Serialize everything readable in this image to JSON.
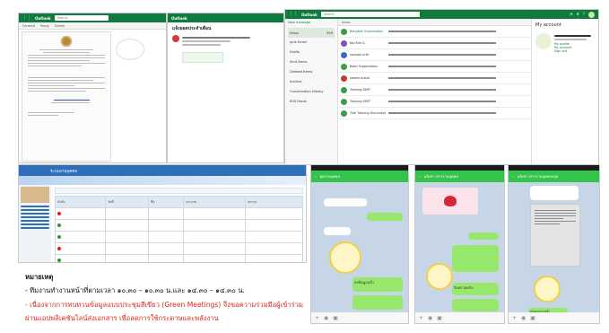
{
  "outlook_left": {
    "brand": "Outlook",
    "search_placeholder": "Search",
    "toolbar": [
      "Forward",
      "Reply",
      "Delete"
    ],
    "reader_title": "แจ้งยอดประจำเดือน"
  },
  "outlook_right": {
    "brand": "Outlook",
    "search_placeholder": "Search",
    "new_label": "New message",
    "folders": [
      "Inbox",
      "Junk Email",
      "Drafts",
      "Sent Items",
      "Deleted Items",
      "Archive",
      "Conversation History",
      "RSS Feeds"
    ],
    "counts": [
      "390",
      "",
      "",
      "",
      "",
      "",
      "",
      ""
    ],
    "list_header": "Inbox",
    "senders": [
      "Bangkok Organization",
      "Noi Kim S.",
      "somsak.sr.th",
      "Baan Organization",
      "kasem.public",
      "Training IDMT",
      "Training IDMT",
      "Thai Training Document"
    ],
    "account_title": "My account",
    "account_links": [
      "My profile",
      "My account",
      "Sign out"
    ]
  },
  "portal": {
    "header": "ระบบงานบุคคล",
    "columns": [
      "ลำดับ",
      "วันที่",
      "ชื่อ",
      "ประเภท",
      "สถานะ"
    ]
  },
  "line_chats": [
    {
      "title": "คุยงานบุคคล",
      "time": "15:19",
      "sent_label": "ส่งข้อมูลแล้ว"
    },
    {
      "title": "แจ้งข่าวสารงานบุคคล",
      "time": "15:32",
      "sent_label": "รับทราบครับ"
    },
    {
      "title": "แจ้งข่าวสารงานบุคคลกลุ่ม",
      "time": "15:34",
      "sent_label": "ส่งเอกสารแล้ว"
    }
  ],
  "notes": {
    "heading": "หมายเหตุ",
    "line1": "- ทีมงานทำงานหน้าที่ตามเวลา ๑๐.๓๐ – ๑๐.๓๐ น.และ ๑๔.๓๐ – ๑๔.๓๐ น.",
    "line2": "- เนื่องจากการทบทวนข้อมูลแบบประชุมสีเขียว (Green Meetings) จึงขอความร่วมมือผู้เข้าร่วม",
    "line3": "ผ่านแอปพลิเคชันไลน์ส่งเอกสาร เพื่อลดการใช้กระดาษและพลังงาน"
  },
  "colors": {
    "outlook_green": "#0f7b3e",
    "line_green": "#34c34b",
    "note_red": "#e0241b"
  }
}
